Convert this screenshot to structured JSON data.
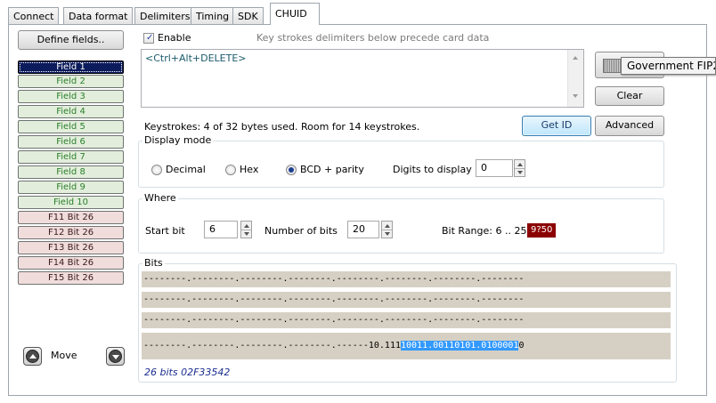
{
  "tabs": [
    {
      "label": "Connect"
    },
    {
      "label": "Data format"
    },
    {
      "label": "Delimiters"
    },
    {
      "label": "Timing"
    },
    {
      "label": "SDK"
    },
    {
      "label": "CHUID"
    }
  ],
  "left": {
    "define_fields": "Define fields..",
    "fields": [
      {
        "label": "Field 1"
      },
      {
        "label": "Field 2"
      },
      {
        "label": "Field 3"
      },
      {
        "label": "Field 4"
      },
      {
        "label": "Field 5"
      },
      {
        "label": "Field 6"
      },
      {
        "label": "Field 7"
      },
      {
        "label": "Field 8"
      },
      {
        "label": "Field 9"
      },
      {
        "label": "Field 10"
      },
      {
        "label": "F11 Bit 26"
      },
      {
        "label": "F12 Bit 26"
      },
      {
        "label": "F13 Bit 26"
      },
      {
        "label": "F14 Bit 26"
      },
      {
        "label": "F15 Bit 26"
      }
    ],
    "move_label": "Move"
  },
  "enable": {
    "label": "Enable",
    "checked": true,
    "note": "Key strokes delimiters below precede card data"
  },
  "keystrokes": {
    "value": "<Ctrl+Alt+DELETE>",
    "info": "Keystrokes: 4 of 32 bytes used. Room for 14 keystrokes."
  },
  "right_buttons": {
    "gov_label": "Government FIP2",
    "clear": "Clear",
    "get_id": "Get ID",
    "advanced": "Advanced"
  },
  "display_mode": {
    "title": "Display mode",
    "options": [
      {
        "label": "Decimal",
        "selected": false
      },
      {
        "label": "Hex",
        "selected": false
      },
      {
        "label": "BCD + parity",
        "selected": true
      }
    ],
    "digits_label": "Digits to display",
    "digits_value": "0"
  },
  "where": {
    "title": "Where",
    "start_label": "Start bit",
    "start_value": "6",
    "nbits_label": "Number of bits",
    "nbits_value": "20",
    "range_label": "Bit Range: 6 .. 25",
    "badge": "9?50"
  },
  "bits": {
    "title": "Bits",
    "rows": [
      "--------.--------.--------.--------.--------.--------.--------.--------",
      "--------.--------.--------.--------.--------.--------.--------.--------",
      "--------.--------.--------.--------.--------.--------.--------.--------"
    ],
    "last_row_pre": "--------.--------.--------.--------.------10.111",
    "last_row_hl": "10011.00110101.0100001",
    "last_row_post": "0",
    "footer": "26 bits 02F33542"
  },
  "colors": {
    "accent": "#3399ff",
    "selected_field": "#0b1b5c",
    "badge": "#8b0000",
    "bits_row": "#d6d0c4"
  }
}
